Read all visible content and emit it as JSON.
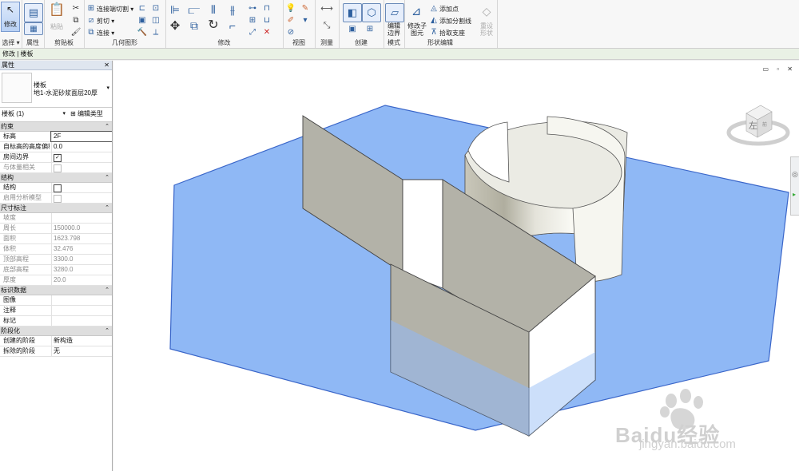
{
  "ribbon": {
    "modify_label": "修改",
    "select_label": "选择",
    "properties_label": "属性",
    "paste_label": "粘贴",
    "clipboard_label": "剪贴板",
    "join_cut_label": "连接端切割",
    "cut_label": "剪切",
    "join_label": "连接",
    "geometry_label": "几何图形",
    "modify_panel_label": "修改",
    "view_label": "视图",
    "measure_label": "测量",
    "create_label": "创建",
    "edit_boundary_label": "编辑边界",
    "mode_label": "模式",
    "modify_sub_label": "修改子图元",
    "add_point_label": "添加点",
    "add_split_label": "添加分割线",
    "pick_support_label": "拾取支座",
    "reset_shape_label": "重设形状",
    "shape_edit_label": "形状编辑"
  },
  "context_bar": {
    "text": "修改 | 楼板"
  },
  "properties": {
    "title": "属性",
    "type_name": "楼板",
    "type_sub": "地1-水泥砂浆面层20厚",
    "instance_selector": "楼板 (1)",
    "edit_type_label": "编辑类型",
    "groups": [
      {
        "title": "约束",
        "rows": [
          {
            "k": "标高",
            "v": "2F",
            "dim": false,
            "edit": true
          },
          {
            "k": "自标高的高度偏移",
            "v": "0.0",
            "dim": false
          },
          {
            "k": "房间边界",
            "check": true,
            "dim": false
          },
          {
            "k": "与体量相关",
            "check": false,
            "dim": true
          }
        ]
      },
      {
        "title": "结构",
        "rows": [
          {
            "k": "结构",
            "check": false,
            "dim": false
          },
          {
            "k": "启用分析模型",
            "check": false,
            "dim": true
          }
        ]
      },
      {
        "title": "尺寸标注",
        "rows": [
          {
            "k": "坡度",
            "v": "",
            "dim": true
          },
          {
            "k": "周长",
            "v": "150000.0",
            "dim": true
          },
          {
            "k": "面积",
            "v": "1623.798",
            "dim": true
          },
          {
            "k": "体积",
            "v": "32.476",
            "dim": true
          },
          {
            "k": "顶部高程",
            "v": "3300.0",
            "dim": true
          },
          {
            "k": "底部高程",
            "v": "3280.0",
            "dim": true
          },
          {
            "k": "厚度",
            "v": "20.0",
            "dim": true
          }
        ]
      },
      {
        "title": "标识数据",
        "rows": [
          {
            "k": "图像",
            "v": "",
            "dim": false
          },
          {
            "k": "注释",
            "v": "",
            "dim": false
          },
          {
            "k": "标记",
            "v": "",
            "dim": false
          }
        ]
      },
      {
        "title": "阶段化",
        "rows": [
          {
            "k": "创建的阶段",
            "v": "新构造",
            "dim": false
          },
          {
            "k": "拆除的阶段",
            "v": "无",
            "dim": false
          }
        ]
      }
    ]
  },
  "viewcube": {
    "face_label": "左",
    "side_label": "前"
  },
  "watermark": {
    "brand": "Baidu经验",
    "url": "jingyan.baidu.com"
  },
  "colors": {
    "floor_fill": "#8fb8f5",
    "floor_edge": "#3a66c9",
    "wall_gray": "#b3b2a8"
  }
}
